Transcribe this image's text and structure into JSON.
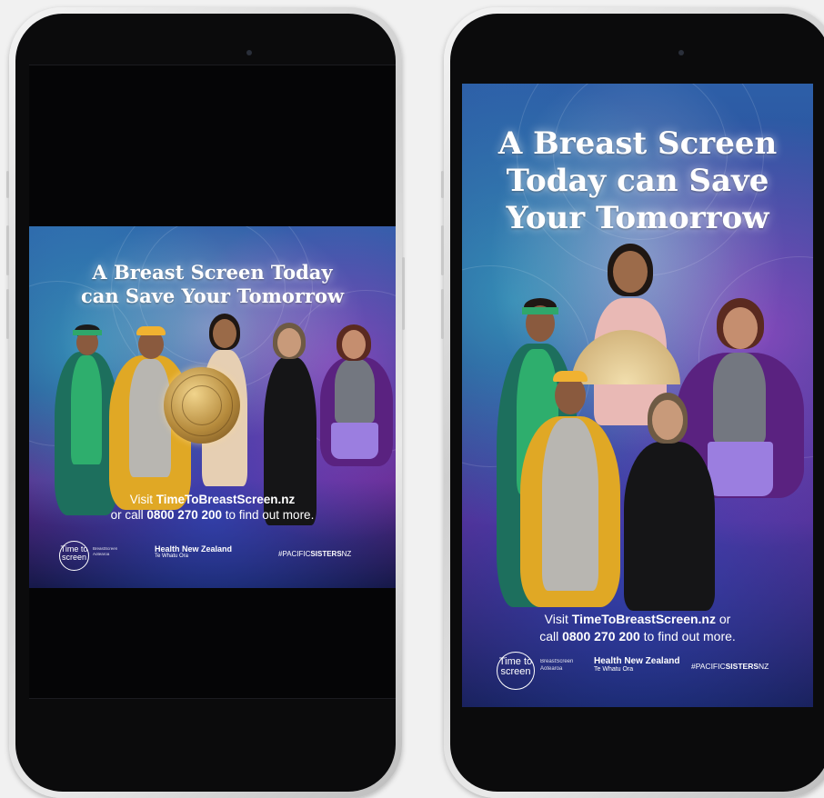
{
  "colors": {
    "poster_deep": "#16194a",
    "accent": "#ffffff"
  },
  "square_ad": {
    "headline_line1": "A Breast Screen Today",
    "headline_line2": "can Save Your Tomorrow",
    "visit_prefix": "Visit ",
    "visit_url": "TimeToBreastScreen.nz",
    "call_prefix": "or call ",
    "call_number": "0800 270 200",
    "call_suffix": " to find out more.",
    "logo_line1": "Time to",
    "logo_line2": "screen",
    "logo_sub1": "BreastScreen",
    "logo_sub2": "Aotearoa",
    "org_name": "Health New Zealand",
    "org_sub": "Te Whatu Ora",
    "hashtag_prefix": "#PACIFIC",
    "hashtag_bold": "SISTERS",
    "hashtag_suffix": "NZ"
  },
  "portrait_ad": {
    "headline_line1": "A Breast Screen",
    "headline_line2": "Today can Save",
    "headline_line3": "Your Tomorrow",
    "visit_prefix": "Visit ",
    "visit_url": "TimeToBreastScreen.nz",
    "visit_suffix": " or",
    "call_prefix": "call ",
    "call_number": "0800 270 200",
    "call_suffix": " to find out more.",
    "logo_line1": "Time to",
    "logo_line2": "screen",
    "logo_sub1": "BreastScreen",
    "logo_sub2": "Aotearoa",
    "org_name": "Health New Zealand",
    "org_sub": "Te Whatu Ora",
    "hashtag_prefix": "#PACIFIC",
    "hashtag_bold": "SISTERS",
    "hashtag_suffix": "NZ"
  }
}
